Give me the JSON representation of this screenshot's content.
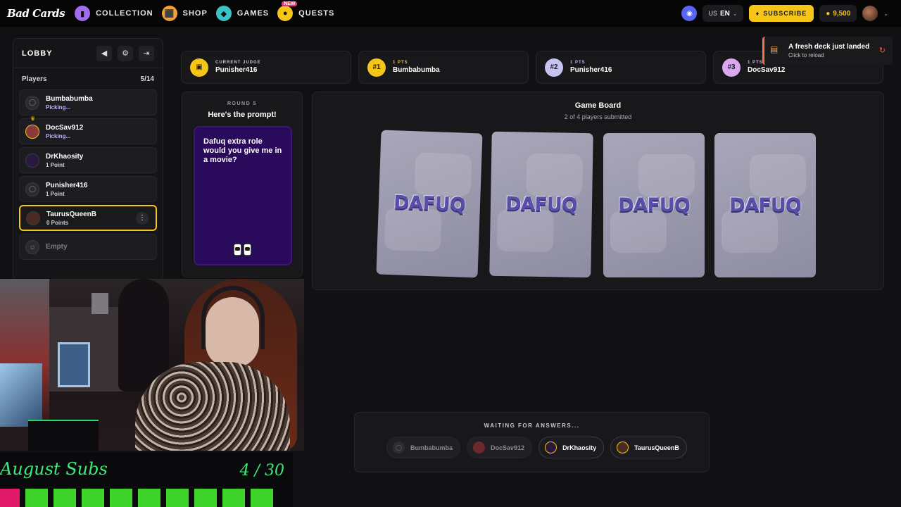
{
  "topbar": {
    "logo": "Bad Cards",
    "nav": [
      {
        "label": "COLLECTION",
        "icon": "collection-icon",
        "color": "#a06cf0"
      },
      {
        "label": "SHOP",
        "icon": "shop-icon",
        "color": "#f5a030"
      },
      {
        "label": "GAMES",
        "icon": "games-icon",
        "color": "#3ac4c8"
      },
      {
        "label": "QUESTS",
        "icon": "quests-icon",
        "color": "#f5c518",
        "badge": "NEW"
      }
    ],
    "lang_region": "US",
    "lang": "EN",
    "subscribe": "SUBSCRIBE",
    "coins": "9,500"
  },
  "lobby": {
    "title": "LOBBY",
    "players_label": "Players",
    "players_count": "5/14",
    "players": [
      {
        "name": "Bumbabumba",
        "status": "Picking..."
      },
      {
        "name": "DocSav912",
        "status": "Picking..."
      },
      {
        "name": "DrKhaosity",
        "status": "1 Point"
      },
      {
        "name": "Punisher416",
        "status": "1 Point"
      },
      {
        "name": "TaurusQueenB",
        "status": "0 Points"
      },
      {
        "name": "Empty",
        "status": ""
      }
    ]
  },
  "scoreboard": [
    {
      "label": "CURRENT JUDGE",
      "name": "Punisher416",
      "badge": ""
    },
    {
      "label": "1 PTS",
      "name": "Bumbabumba",
      "badge": "#1"
    },
    {
      "label": "1 PTS",
      "name": "Punisher416",
      "badge": "#2"
    },
    {
      "label": "1 PTS",
      "name": "DocSav912",
      "badge": "#3"
    }
  ],
  "toast": {
    "title": "A fresh deck just landed",
    "subtitle": "Click to reload"
  },
  "prompt": {
    "round": "ROUND 5",
    "title": "Here's the prompt!",
    "text": "Dafuq extra role would you give me in a movie?"
  },
  "board": {
    "title": "Game Board",
    "subtitle": "2 of 4 players submitted",
    "card_word": "DAFUQ"
  },
  "waiting": {
    "title": "WAITING FOR ANSWERS...",
    "players": [
      "Bumbabumba",
      "DocSav912",
      "DrKhaosity",
      "TaurusQueenB"
    ]
  },
  "stream_overlay": {
    "subs_label": "August Subs",
    "subs_count": "4 / 30"
  },
  "colors": {
    "accent_yellow": "#f5c518",
    "subs_green": "#3bea7a",
    "prompt_purple": "#2a0a5a",
    "toast_orange": "#f5744a"
  }
}
